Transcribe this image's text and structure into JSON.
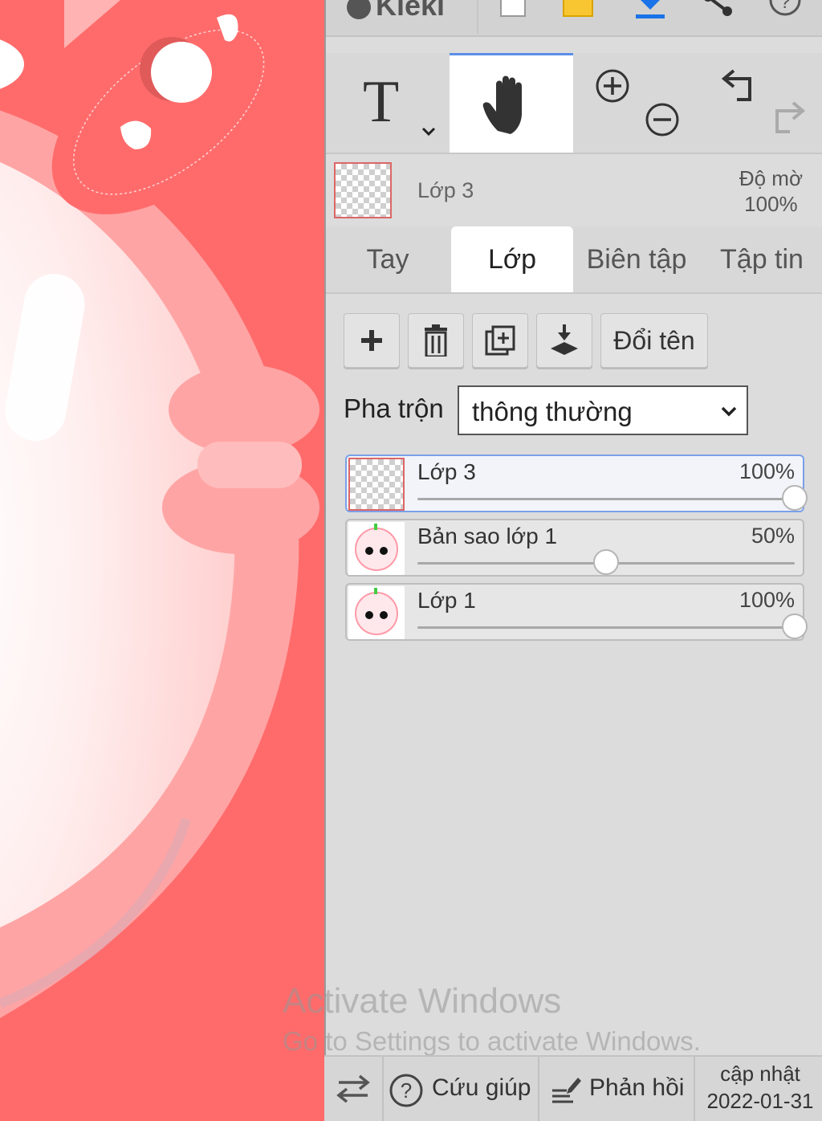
{
  "app": {
    "logo_text": "Kleki"
  },
  "toolbar": {
    "tools": [
      "text",
      "hand",
      "zoom",
      "undo-redo"
    ]
  },
  "layer_info": {
    "name": "Lớp 3",
    "opacity_label": "Độ mờ",
    "opacity_value": "100%"
  },
  "tabs": [
    {
      "label": "Tay",
      "active": false
    },
    {
      "label": "Lớp",
      "active": true
    },
    {
      "label": "Biên tập",
      "active": false
    },
    {
      "label": "Tập tin",
      "active": false
    }
  ],
  "layer_actions": {
    "rename_label": "Đổi tên"
  },
  "blend": {
    "label": "Pha trộn",
    "value": "thông thường"
  },
  "layers": [
    {
      "name": "Lớp 3",
      "percent": "100%",
      "level": 1.0,
      "active": true
    },
    {
      "name": "Bản sao lớp 1",
      "percent": "50%",
      "level": 0.5,
      "active": false
    },
    {
      "name": "Lớp 1",
      "percent": "100%",
      "level": 1.0,
      "active": false
    }
  ],
  "watermark": {
    "line1": "Activate Windows",
    "line2": "Go to Settings to activate Windows."
  },
  "bottom": {
    "help_label": "Cứu giúp",
    "feedback_label": "Phản hồi",
    "update_label": "cập nhật",
    "update_date": "2022-01-31"
  },
  "colors": {
    "canvas_bg": "#ff6b6b",
    "accent": "#5b8ee6"
  }
}
